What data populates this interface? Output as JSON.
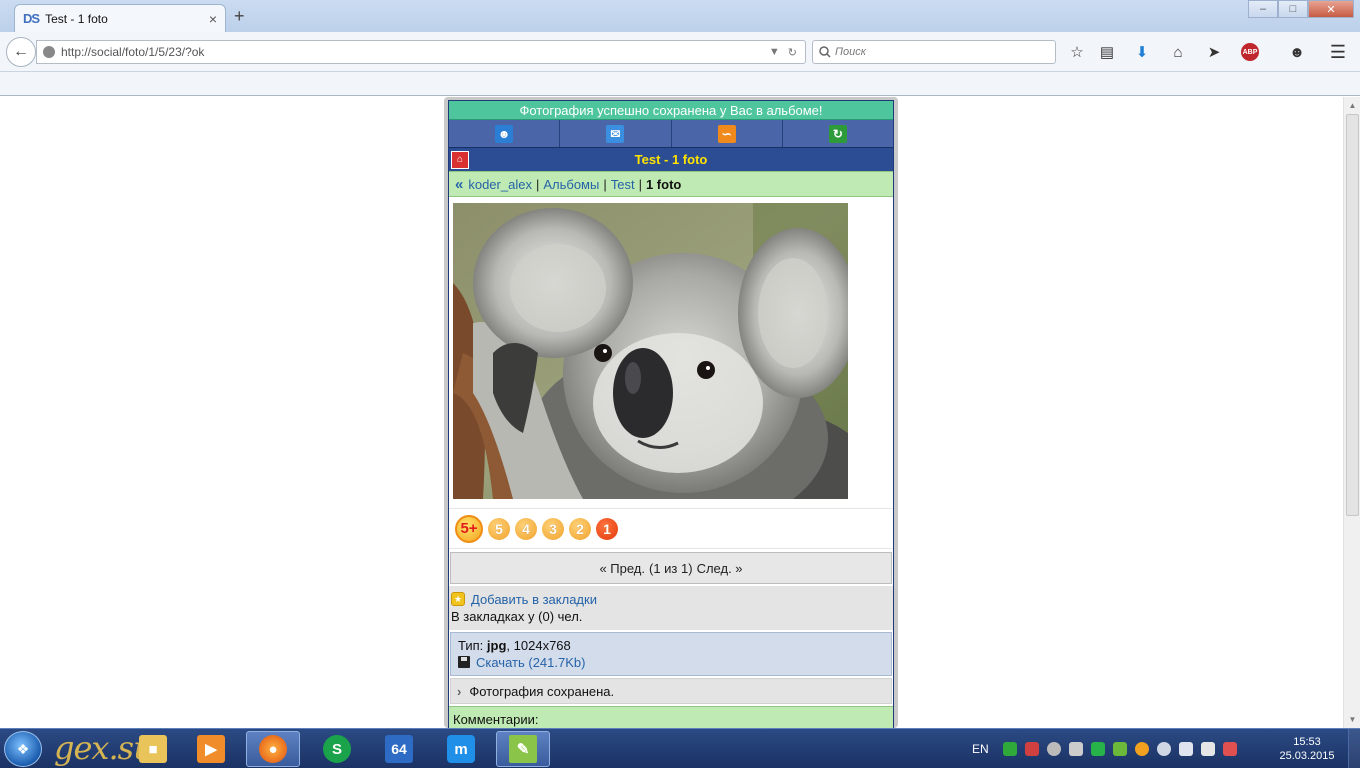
{
  "browser": {
    "tab_favicon": "DS",
    "tab_title": "Test - 1 foto",
    "tab_close": "×",
    "new_tab": "+",
    "url": "http://social/foto/1/5/23/?ok",
    "search_placeholder": "Поиск",
    "abp_label": "ABP",
    "window_buttons": {
      "minimize": "‒",
      "maximize": "□",
      "close": "✕"
    }
  },
  "page": {
    "notice": "Фотография успешно сохранена у Вас в альбоме!",
    "top_icons": [
      "profile-icon",
      "mail-icon",
      "rss-icon",
      "refresh-icon"
    ],
    "title": "Test - 1 foto",
    "breadcrumb": {
      "prefix": "«",
      "user": "koder_alex",
      "albums": "Альбомы",
      "album": "Test",
      "current": "1 foto",
      "separator": "|"
    },
    "rating": {
      "special": "5+",
      "values": [
        "5",
        "4",
        "3",
        "2",
        "1"
      ]
    },
    "pager": {
      "prev": "« Пред.",
      "position": "(1 из 1)",
      "next": "След. »"
    },
    "bookmarks": {
      "add_label": "Добавить в закладки",
      "count_text": "В закладках у (0) чел."
    },
    "file_info": {
      "type_label": "Тип:",
      "type_value": "jpg",
      "dimensions": ", 1024x768",
      "download_label": "Скачать (241.7Kb)"
    },
    "saved_text": "Фотография сохранена.",
    "comments_label": "Комментарии:"
  },
  "taskbar": {
    "watermark": "gex.su",
    "language": "EN",
    "time": "15:53",
    "date": "25.03.2015",
    "apps": [
      "windows-start",
      "explorer",
      "media-player",
      "firefox",
      "skype",
      "aida64",
      "maxthon",
      "notepad"
    ]
  },
  "colors": {
    "notice_bg": "#4ec59d",
    "titlebar_bg": "#2c4d93",
    "title_text": "#ffe400",
    "crumbs_bg": "#c0eab3",
    "link": "#2563a8"
  }
}
